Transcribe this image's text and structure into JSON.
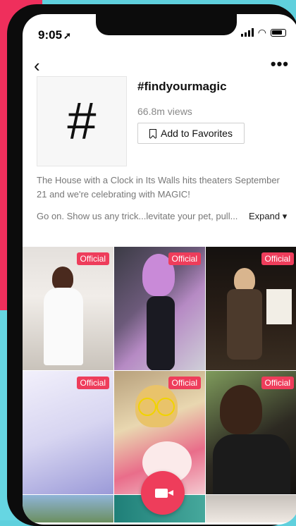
{
  "status": {
    "time": "9:05",
    "location_icon": "location-arrow-icon"
  },
  "header": {
    "back_icon": "back-chevron-icon",
    "more_icon": "more-dots-icon"
  },
  "hashtag": {
    "symbol": "#",
    "title": "#findyourmagic",
    "views": "66.8m views",
    "favorites_label": "Add to Favorites"
  },
  "description": {
    "line1": "The House with a Clock in Its Walls hits theaters September 21 and we're celebrating with MAGIC!",
    "line2": "Go on. Show us any trick...levitate your pet, pull...",
    "expand_label": "Expand ▾"
  },
  "videos": [
    {
      "badge": "Official"
    },
    {
      "badge": "Official"
    },
    {
      "badge": "Official"
    },
    {
      "badge": "Official"
    },
    {
      "badge": "Official"
    },
    {
      "badge": "Official"
    }
  ],
  "colors": {
    "accent": "#ee3d5b"
  },
  "record_icon": "video-camera-icon"
}
